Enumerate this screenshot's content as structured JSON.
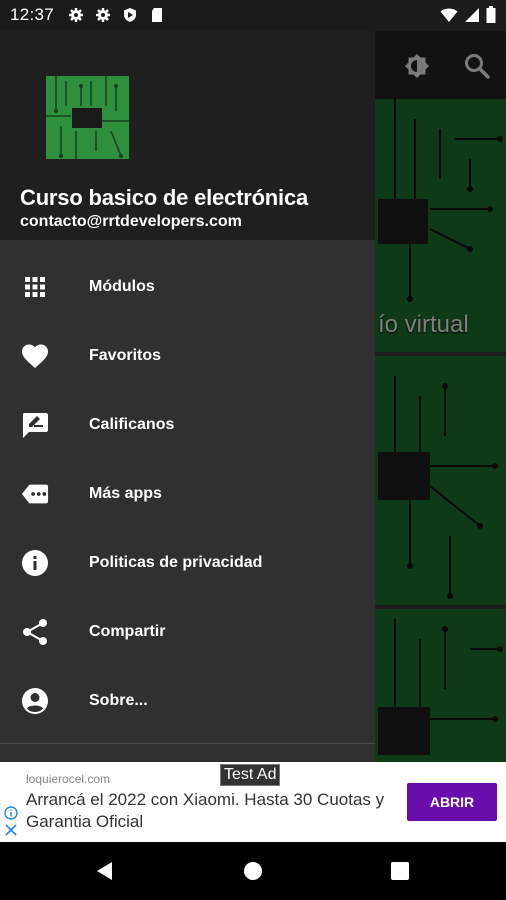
{
  "status_bar": {
    "time": "12:37",
    "left_icons": [
      "gear-icon",
      "gear-icon",
      "shield-icon",
      "sd-card-icon"
    ],
    "right_icons": [
      "wifi-icon",
      "signal-icon",
      "battery-icon"
    ]
  },
  "app_bar": {
    "icons": [
      "brightness-icon",
      "search-icon"
    ]
  },
  "background_cards": [
    {
      "title_fragment": "ío virtual"
    },
    {
      "title_fragment": ""
    },
    {
      "title_fragment": ""
    }
  ],
  "drawer": {
    "app_name": "Curso basico de electrónica",
    "email": "contacto@rrtdevelopers.com",
    "items": [
      {
        "label": "Módulos",
        "icon": "grid-icon"
      },
      {
        "label": "Favoritos",
        "icon": "heart-icon"
      },
      {
        "label": "Calificanos",
        "icon": "rate-review-icon"
      },
      {
        "label": "Más apps",
        "icon": "more-apps-icon"
      },
      {
        "label": "Politicas de privacidad",
        "icon": "info-icon"
      },
      {
        "label": "Compartir",
        "icon": "share-icon"
      },
      {
        "label": "Sobre...",
        "icon": "account-circle-icon"
      }
    ]
  },
  "ad": {
    "badge": "Test Ad",
    "domain": "loquierocel.com",
    "headline": "Arrancá el 2022 con Xiaomi. Hasta 30 Cuotas y Garantia Oficial",
    "button": "ABRIR",
    "button_color": "#6a0dad"
  },
  "nav_bar": {
    "icons": [
      "back-icon",
      "home-icon",
      "recents-icon"
    ]
  }
}
